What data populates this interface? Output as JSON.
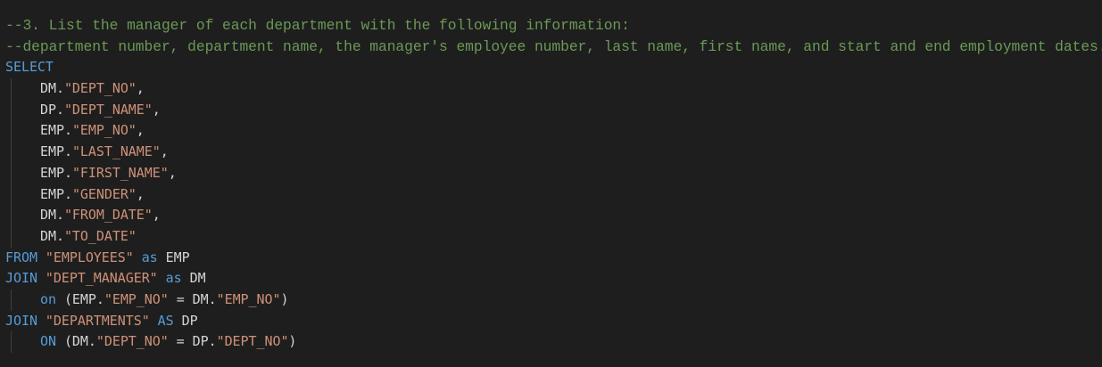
{
  "editor": {
    "lines": [
      {
        "type": "comment",
        "text": "--3. List the manager of each department with the following information:"
      },
      {
        "type": "comment",
        "text": "--department number, department name, the manager's employee number, last name, first name, and start and end employment dates."
      },
      {
        "type": "code",
        "tokens": [
          {
            "kind": "kw",
            "text": "SELECT"
          }
        ]
      },
      {
        "type": "code",
        "indent": 1,
        "tokens": [
          {
            "kind": "ident",
            "text": "DM."
          },
          {
            "kind": "str",
            "text": "\"DEPT_NO\""
          },
          {
            "kind": "punct",
            "text": ","
          }
        ]
      },
      {
        "type": "code",
        "indent": 1,
        "tokens": [
          {
            "kind": "ident",
            "text": "DP."
          },
          {
            "kind": "str",
            "text": "\"DEPT_NAME\""
          },
          {
            "kind": "punct",
            "text": ","
          }
        ]
      },
      {
        "type": "code",
        "indent": 1,
        "tokens": [
          {
            "kind": "ident",
            "text": "EMP."
          },
          {
            "kind": "str",
            "text": "\"EMP_NO\""
          },
          {
            "kind": "punct",
            "text": ","
          }
        ]
      },
      {
        "type": "code",
        "indent": 1,
        "tokens": [
          {
            "kind": "ident",
            "text": "EMP."
          },
          {
            "kind": "str",
            "text": "\"LAST_NAME\""
          },
          {
            "kind": "punct",
            "text": ","
          }
        ]
      },
      {
        "type": "code",
        "indent": 1,
        "tokens": [
          {
            "kind": "ident",
            "text": "EMP."
          },
          {
            "kind": "str",
            "text": "\"FIRST_NAME\""
          },
          {
            "kind": "punct",
            "text": ","
          }
        ]
      },
      {
        "type": "code",
        "indent": 1,
        "tokens": [
          {
            "kind": "ident",
            "text": "EMP."
          },
          {
            "kind": "str",
            "text": "\"GENDER\""
          },
          {
            "kind": "punct",
            "text": ","
          }
        ]
      },
      {
        "type": "code",
        "indent": 1,
        "tokens": [
          {
            "kind": "ident",
            "text": "DM."
          },
          {
            "kind": "str",
            "text": "\"FROM_DATE\""
          },
          {
            "kind": "punct",
            "text": ","
          }
        ]
      },
      {
        "type": "code",
        "indent": 1,
        "tokens": [
          {
            "kind": "ident",
            "text": "DM."
          },
          {
            "kind": "str",
            "text": "\"TO_DATE\""
          }
        ]
      },
      {
        "type": "code",
        "tokens": [
          {
            "kind": "kw",
            "text": "FROM"
          },
          {
            "kind": "punct",
            "text": " "
          },
          {
            "kind": "str",
            "text": "\"EMPLOYEES\""
          },
          {
            "kind": "punct",
            "text": " "
          },
          {
            "kind": "kw",
            "text": "as"
          },
          {
            "kind": "ident",
            "text": " EMP"
          }
        ]
      },
      {
        "type": "code",
        "tokens": [
          {
            "kind": "kw",
            "text": "JOIN"
          },
          {
            "kind": "punct",
            "text": " "
          },
          {
            "kind": "str",
            "text": "\"DEPT_MANAGER\""
          },
          {
            "kind": "punct",
            "text": " "
          },
          {
            "kind": "kw",
            "text": "as"
          },
          {
            "kind": "ident",
            "text": " DM"
          }
        ]
      },
      {
        "type": "code",
        "indent": 1,
        "tokens": [
          {
            "kind": "kw",
            "text": "on"
          },
          {
            "kind": "ident",
            "text": " (EMP."
          },
          {
            "kind": "str",
            "text": "\"EMP_NO\""
          },
          {
            "kind": "ident",
            "text": " = DM."
          },
          {
            "kind": "str",
            "text": "\"EMP_NO\""
          },
          {
            "kind": "punct",
            "text": ")"
          }
        ]
      },
      {
        "type": "code",
        "tokens": [
          {
            "kind": "kw",
            "text": "JOIN"
          },
          {
            "kind": "punct",
            "text": " "
          },
          {
            "kind": "str",
            "text": "\"DEPARTMENTS\""
          },
          {
            "kind": "punct",
            "text": " "
          },
          {
            "kind": "kw",
            "text": "AS"
          },
          {
            "kind": "ident",
            "text": " DP"
          }
        ]
      },
      {
        "type": "code",
        "indent": 1,
        "tokens": [
          {
            "kind": "kw",
            "text": "ON"
          },
          {
            "kind": "ident",
            "text": " (DM."
          },
          {
            "kind": "str",
            "text": "\"DEPT_NO\""
          },
          {
            "kind": "ident",
            "text": " = DP."
          },
          {
            "kind": "str",
            "text": "\"DEPT_NO\""
          },
          {
            "kind": "punct",
            "text": ")"
          }
        ]
      }
    ]
  },
  "colors": {
    "background": "#1e1e1e",
    "comment": "#6a9955",
    "keyword": "#569cd6",
    "string": "#ce9178",
    "identifier": "#d4d4d4"
  }
}
